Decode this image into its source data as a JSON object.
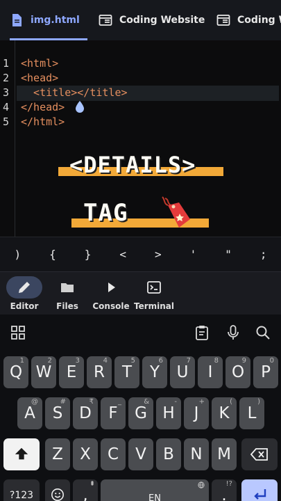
{
  "tabs": [
    {
      "label": "img.html",
      "icon": "file-icon",
      "active": true
    },
    {
      "label": "Coding Website",
      "icon": "window-icon",
      "active": false
    },
    {
      "label": "Coding Website",
      "icon": "window-icon",
      "active": false
    }
  ],
  "editor": {
    "line_numbers": [
      "1",
      "2",
      "3",
      "4",
      "5"
    ],
    "lines": [
      "<html>",
      "<head>",
      "  <title></title>",
      "</head>",
      "</html>"
    ],
    "banner": {
      "line1": "<DETAILS>",
      "line2": "TAG"
    }
  },
  "symbols": [
    ")",
    "{",
    "}",
    "<",
    ">",
    "'",
    "\"",
    ";"
  ],
  "nav": [
    {
      "label": "Editor",
      "icon": "pencil-icon",
      "active": true
    },
    {
      "label": "Files",
      "icon": "folder-icon",
      "active": false
    },
    {
      "label": "Console",
      "icon": "play-icon",
      "active": false
    },
    {
      "label": "Terminal",
      "icon": "terminal-icon",
      "active": false
    }
  ],
  "keyboard": {
    "row1": [
      {
        "key": "Q",
        "hint": "1"
      },
      {
        "key": "W",
        "hint": "2"
      },
      {
        "key": "E",
        "hint": "3"
      },
      {
        "key": "R",
        "hint": "4"
      },
      {
        "key": "T",
        "hint": "5"
      },
      {
        "key": "Y",
        "hint": "6"
      },
      {
        "key": "U",
        "hint": "7"
      },
      {
        "key": "I",
        "hint": "8"
      },
      {
        "key": "O",
        "hint": "9"
      },
      {
        "key": "P",
        "hint": "0"
      }
    ],
    "row2": [
      {
        "key": "A",
        "hint": "@"
      },
      {
        "key": "S",
        "hint": "#"
      },
      {
        "key": "D",
        "hint": "₹"
      },
      {
        "key": "F",
        "hint": "_"
      },
      {
        "key": "G",
        "hint": "&"
      },
      {
        "key": "H",
        "hint": "-"
      },
      {
        "key": "J",
        "hint": "+"
      },
      {
        "key": "K",
        "hint": "("
      },
      {
        "key": "L",
        "hint": ")"
      }
    ],
    "row3": [
      {
        "key": "Z",
        "hint": ""
      },
      {
        "key": "X",
        "hint": ""
      },
      {
        "key": "C",
        "hint": ""
      },
      {
        "key": "V",
        "hint": ""
      },
      {
        "key": "B",
        "hint": ""
      },
      {
        "key": "N",
        "hint": ""
      },
      {
        "key": "M",
        "hint": ""
      }
    ],
    "symbols_key": "?123",
    "comma_hint": ",",
    "space_label": "EN",
    "punct_hint": "!?",
    "punct_key": "."
  },
  "colors": {
    "accent": "#8ea8ff",
    "code": "#e58f5f",
    "banner": "#f2a938"
  }
}
